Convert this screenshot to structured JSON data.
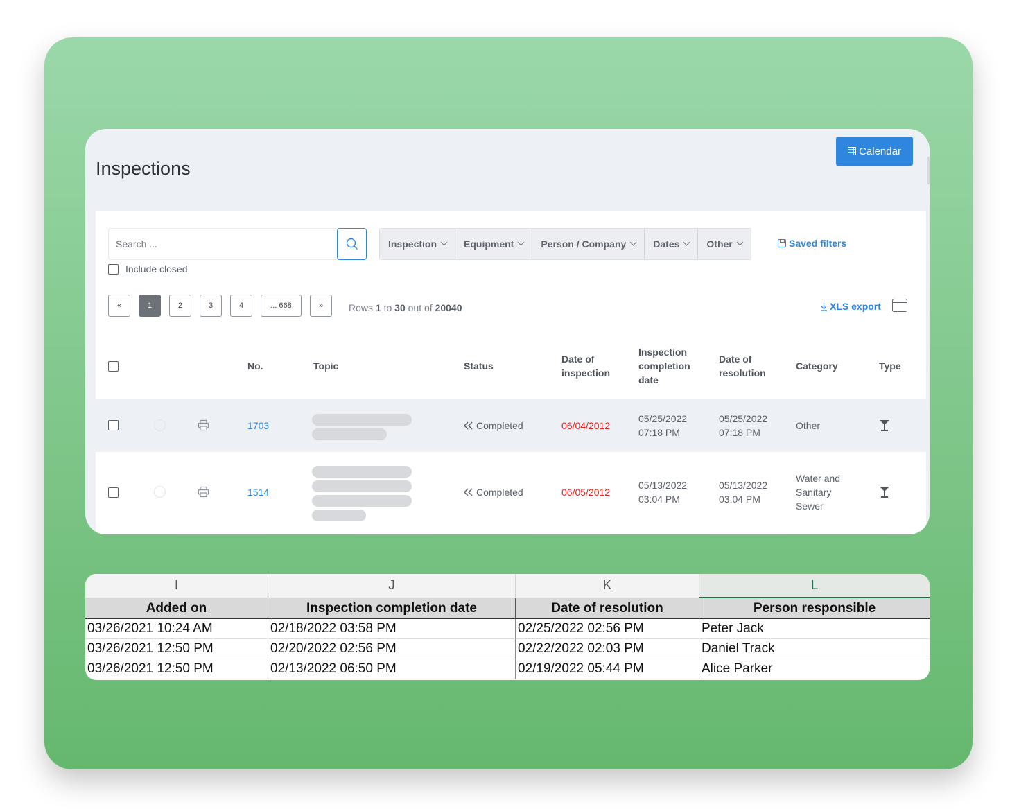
{
  "page": {
    "title": "Inspections"
  },
  "toolbar": {
    "calendar_label": "Calendar"
  },
  "search": {
    "placeholder": "Search ...",
    "value": ""
  },
  "include_closed": {
    "label": "Include closed",
    "checked": false
  },
  "filters": [
    "Inspection",
    "Equipment",
    "Person / Company",
    "Dates",
    "Other"
  ],
  "saved_filters_label": "Saved filters",
  "pagination": {
    "prev": "«",
    "pages": [
      "1",
      "2",
      "3",
      "4",
      "... 668"
    ],
    "next": "»",
    "current": "1"
  },
  "rows_info": {
    "prefix": "Rows",
    "from": "1",
    "to_word": "to",
    "to": "30",
    "out_of_word": "out of",
    "total": "20040"
  },
  "xls_export_label": "XLS export",
  "table": {
    "headers": {
      "no": "No.",
      "topic": "Topic",
      "status": "Status",
      "date_of_inspection": [
        "Date of",
        "inspection"
      ],
      "completion_date": [
        "Inspection",
        "completion",
        "date"
      ],
      "resolution_date": [
        "Date of",
        "resolution"
      ],
      "category": "Category",
      "type": "Type"
    },
    "rows": [
      {
        "no": "1703",
        "status": "Completed",
        "date_of_inspection": "06/04/2012",
        "completion_date": [
          "05/25/2022",
          "07:18 PM"
        ],
        "resolution_date": [
          "05/25/2022",
          "07:18 PM"
        ],
        "category": [
          "Other"
        ]
      },
      {
        "no": "1514",
        "status": "Completed",
        "date_of_inspection": "06/05/2012",
        "completion_date": [
          "05/13/2022",
          "03:04 PM"
        ],
        "resolution_date": [
          "05/13/2022",
          "03:04 PM"
        ],
        "category": [
          "Water and",
          "Sanitary",
          "Sewer"
        ]
      }
    ]
  },
  "spreadsheet": {
    "columns": [
      "I",
      "J",
      "K",
      "L"
    ],
    "selected_column": "L",
    "headers": [
      "Added on",
      "Inspection completion date",
      "Date of resolution",
      "Person responsible"
    ],
    "rows": [
      [
        "03/26/2021 10:24 AM",
        "02/18/2022 03:58 PM",
        "02/25/2022 02:56 PM",
        "Peter Jack"
      ],
      [
        "03/26/2021 12:50 PM",
        "02/20/2022 02:56 PM",
        "02/22/2022 02:03 PM",
        "Daniel Track"
      ],
      [
        "03/26/2021 12:50 PM",
        "02/13/2022 06:50 PM",
        "02/19/2022 05:44 PM",
        "Alice Parker"
      ]
    ]
  },
  "colors": {
    "accent": "#2f86de",
    "overdue": "#e0231f",
    "excel_green": "#1e7145",
    "background_green": "#83c98f"
  }
}
